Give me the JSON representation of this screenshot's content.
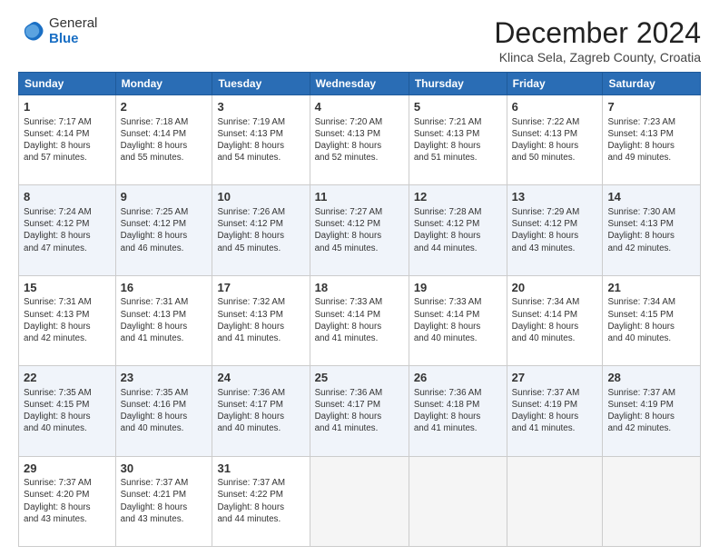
{
  "logo": {
    "general": "General",
    "blue": "Blue"
  },
  "title": "December 2024",
  "subtitle": "Klinca Sela, Zagreb County, Croatia",
  "days_of_week": [
    "Sunday",
    "Monday",
    "Tuesday",
    "Wednesday",
    "Thursday",
    "Friday",
    "Saturday"
  ],
  "weeks": [
    [
      {
        "day": "1",
        "info": "Sunrise: 7:17 AM\nSunset: 4:14 PM\nDaylight: 8 hours\nand 57 minutes."
      },
      {
        "day": "2",
        "info": "Sunrise: 7:18 AM\nSunset: 4:14 PM\nDaylight: 8 hours\nand 55 minutes."
      },
      {
        "day": "3",
        "info": "Sunrise: 7:19 AM\nSunset: 4:13 PM\nDaylight: 8 hours\nand 54 minutes."
      },
      {
        "day": "4",
        "info": "Sunrise: 7:20 AM\nSunset: 4:13 PM\nDaylight: 8 hours\nand 52 minutes."
      },
      {
        "day": "5",
        "info": "Sunrise: 7:21 AM\nSunset: 4:13 PM\nDaylight: 8 hours\nand 51 minutes."
      },
      {
        "day": "6",
        "info": "Sunrise: 7:22 AM\nSunset: 4:13 PM\nDaylight: 8 hours\nand 50 minutes."
      },
      {
        "day": "7",
        "info": "Sunrise: 7:23 AM\nSunset: 4:13 PM\nDaylight: 8 hours\nand 49 minutes."
      }
    ],
    [
      {
        "day": "8",
        "info": "Sunrise: 7:24 AM\nSunset: 4:12 PM\nDaylight: 8 hours\nand 47 minutes."
      },
      {
        "day": "9",
        "info": "Sunrise: 7:25 AM\nSunset: 4:12 PM\nDaylight: 8 hours\nand 46 minutes."
      },
      {
        "day": "10",
        "info": "Sunrise: 7:26 AM\nSunset: 4:12 PM\nDaylight: 8 hours\nand 45 minutes."
      },
      {
        "day": "11",
        "info": "Sunrise: 7:27 AM\nSunset: 4:12 PM\nDaylight: 8 hours\nand 45 minutes."
      },
      {
        "day": "12",
        "info": "Sunrise: 7:28 AM\nSunset: 4:12 PM\nDaylight: 8 hours\nand 44 minutes."
      },
      {
        "day": "13",
        "info": "Sunrise: 7:29 AM\nSunset: 4:12 PM\nDaylight: 8 hours\nand 43 minutes."
      },
      {
        "day": "14",
        "info": "Sunrise: 7:30 AM\nSunset: 4:13 PM\nDaylight: 8 hours\nand 42 minutes."
      }
    ],
    [
      {
        "day": "15",
        "info": "Sunrise: 7:31 AM\nSunset: 4:13 PM\nDaylight: 8 hours\nand 42 minutes."
      },
      {
        "day": "16",
        "info": "Sunrise: 7:31 AM\nSunset: 4:13 PM\nDaylight: 8 hours\nand 41 minutes."
      },
      {
        "day": "17",
        "info": "Sunrise: 7:32 AM\nSunset: 4:13 PM\nDaylight: 8 hours\nand 41 minutes."
      },
      {
        "day": "18",
        "info": "Sunrise: 7:33 AM\nSunset: 4:14 PM\nDaylight: 8 hours\nand 41 minutes."
      },
      {
        "day": "19",
        "info": "Sunrise: 7:33 AM\nSunset: 4:14 PM\nDaylight: 8 hours\nand 40 minutes."
      },
      {
        "day": "20",
        "info": "Sunrise: 7:34 AM\nSunset: 4:14 PM\nDaylight: 8 hours\nand 40 minutes."
      },
      {
        "day": "21",
        "info": "Sunrise: 7:34 AM\nSunset: 4:15 PM\nDaylight: 8 hours\nand 40 minutes."
      }
    ],
    [
      {
        "day": "22",
        "info": "Sunrise: 7:35 AM\nSunset: 4:15 PM\nDaylight: 8 hours\nand 40 minutes."
      },
      {
        "day": "23",
        "info": "Sunrise: 7:35 AM\nSunset: 4:16 PM\nDaylight: 8 hours\nand 40 minutes."
      },
      {
        "day": "24",
        "info": "Sunrise: 7:36 AM\nSunset: 4:17 PM\nDaylight: 8 hours\nand 40 minutes."
      },
      {
        "day": "25",
        "info": "Sunrise: 7:36 AM\nSunset: 4:17 PM\nDaylight: 8 hours\nand 41 minutes."
      },
      {
        "day": "26",
        "info": "Sunrise: 7:36 AM\nSunset: 4:18 PM\nDaylight: 8 hours\nand 41 minutes."
      },
      {
        "day": "27",
        "info": "Sunrise: 7:37 AM\nSunset: 4:19 PM\nDaylight: 8 hours\nand 41 minutes."
      },
      {
        "day": "28",
        "info": "Sunrise: 7:37 AM\nSunset: 4:19 PM\nDaylight: 8 hours\nand 42 minutes."
      }
    ],
    [
      {
        "day": "29",
        "info": "Sunrise: 7:37 AM\nSunset: 4:20 PM\nDaylight: 8 hours\nand 43 minutes."
      },
      {
        "day": "30",
        "info": "Sunrise: 7:37 AM\nSunset: 4:21 PM\nDaylight: 8 hours\nand 43 minutes."
      },
      {
        "day": "31",
        "info": "Sunrise: 7:37 AM\nSunset: 4:22 PM\nDaylight: 8 hours\nand 44 minutes."
      },
      null,
      null,
      null,
      null
    ]
  ]
}
